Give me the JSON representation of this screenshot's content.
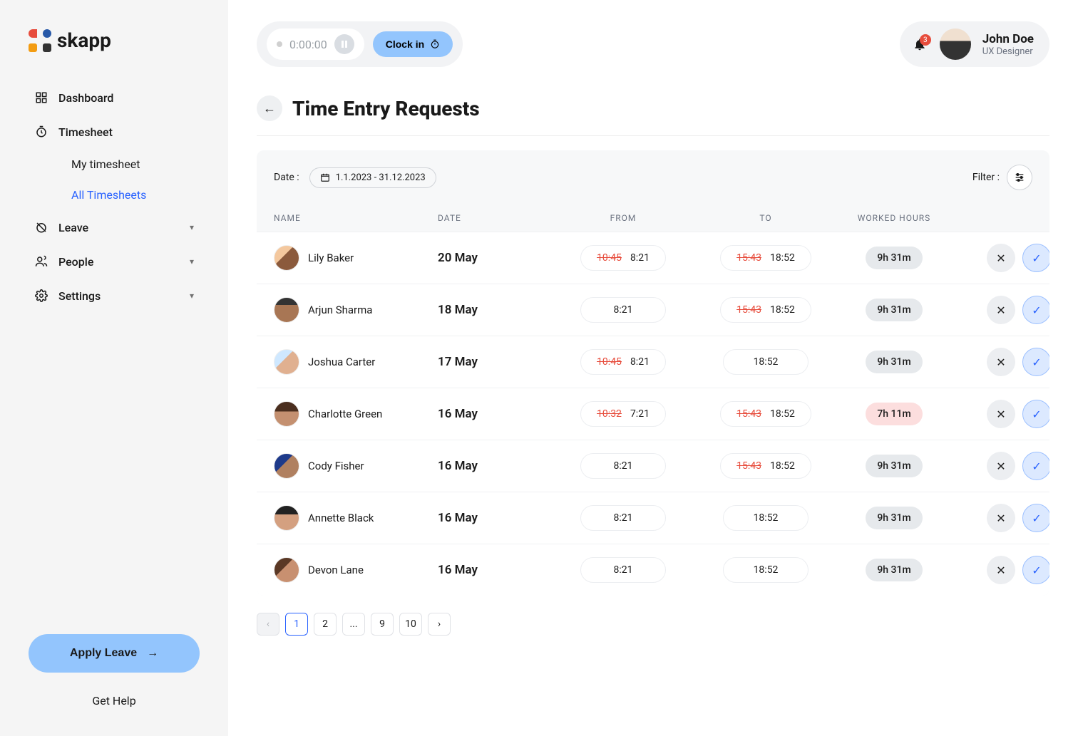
{
  "brand": "skapp",
  "sidebar": {
    "items": [
      {
        "label": "Dashboard"
      },
      {
        "label": "Timesheet"
      },
      {
        "label": "Leave"
      },
      {
        "label": "People"
      },
      {
        "label": "Settings"
      }
    ],
    "sub": [
      {
        "label": "My timesheet"
      },
      {
        "label": "All Timesheets"
      }
    ],
    "apply": "Apply Leave",
    "help": "Get Help"
  },
  "topbar": {
    "timer": "0:00:00",
    "clockin": "Clock in",
    "user": {
      "name": "John Doe",
      "role": "UX Designer"
    },
    "bell_count": "3"
  },
  "page": {
    "title": "Time Entry Requests"
  },
  "toolbar": {
    "date_label": "Date :",
    "date_range": "1.1.2023 - 31.12.2023",
    "filter_label": "Filter :"
  },
  "columns": {
    "name": "NAME",
    "date": "DATE",
    "from": "FROM",
    "to": "TO",
    "hours": "WORKED HOURS"
  },
  "rows": [
    {
      "name": "Lily Baker",
      "date": "20 May",
      "from_old": "10:45",
      "from": "8:21",
      "to_old": "15:43",
      "to": "18:52",
      "hours": "9h 31m",
      "warn": false,
      "av": "av1"
    },
    {
      "name": "Arjun Sharma",
      "date": "18 May",
      "from_old": "",
      "from": "8:21",
      "to_old": "15:43",
      "to": "18:52",
      "hours": "9h 31m",
      "warn": false,
      "av": "av2"
    },
    {
      "name": "Joshua Carter",
      "date": "17 May",
      "from_old": "10:45",
      "from": "8:21",
      "to_old": "",
      "to": "18:52",
      "hours": "9h 31m",
      "warn": false,
      "av": "av3"
    },
    {
      "name": "Charlotte Green",
      "date": "16 May",
      "from_old": "10:32",
      "from": "7:21",
      "to_old": "15:43",
      "to": "18:52",
      "hours": "7h 11m",
      "warn": true,
      "av": "av4"
    },
    {
      "name": "Cody Fisher",
      "date": "16 May",
      "from_old": "",
      "from": "8:21",
      "to_old": "15:43",
      "to": "18:52",
      "hours": "9h 31m",
      "warn": false,
      "av": "av5"
    },
    {
      "name": "Annette Black",
      "date": "16 May",
      "from_old": "",
      "from": "8:21",
      "to_old": "",
      "to": "18:52",
      "hours": "9h 31m",
      "warn": false,
      "av": "av6"
    },
    {
      "name": "Devon Lane",
      "date": "16 May",
      "from_old": "",
      "from": "8:21",
      "to_old": "",
      "to": "18:52",
      "hours": "9h 31m",
      "warn": false,
      "av": "av7"
    }
  ],
  "pagination": {
    "pages": [
      "1",
      "2",
      "...",
      "9",
      "10"
    ],
    "active": "1"
  }
}
